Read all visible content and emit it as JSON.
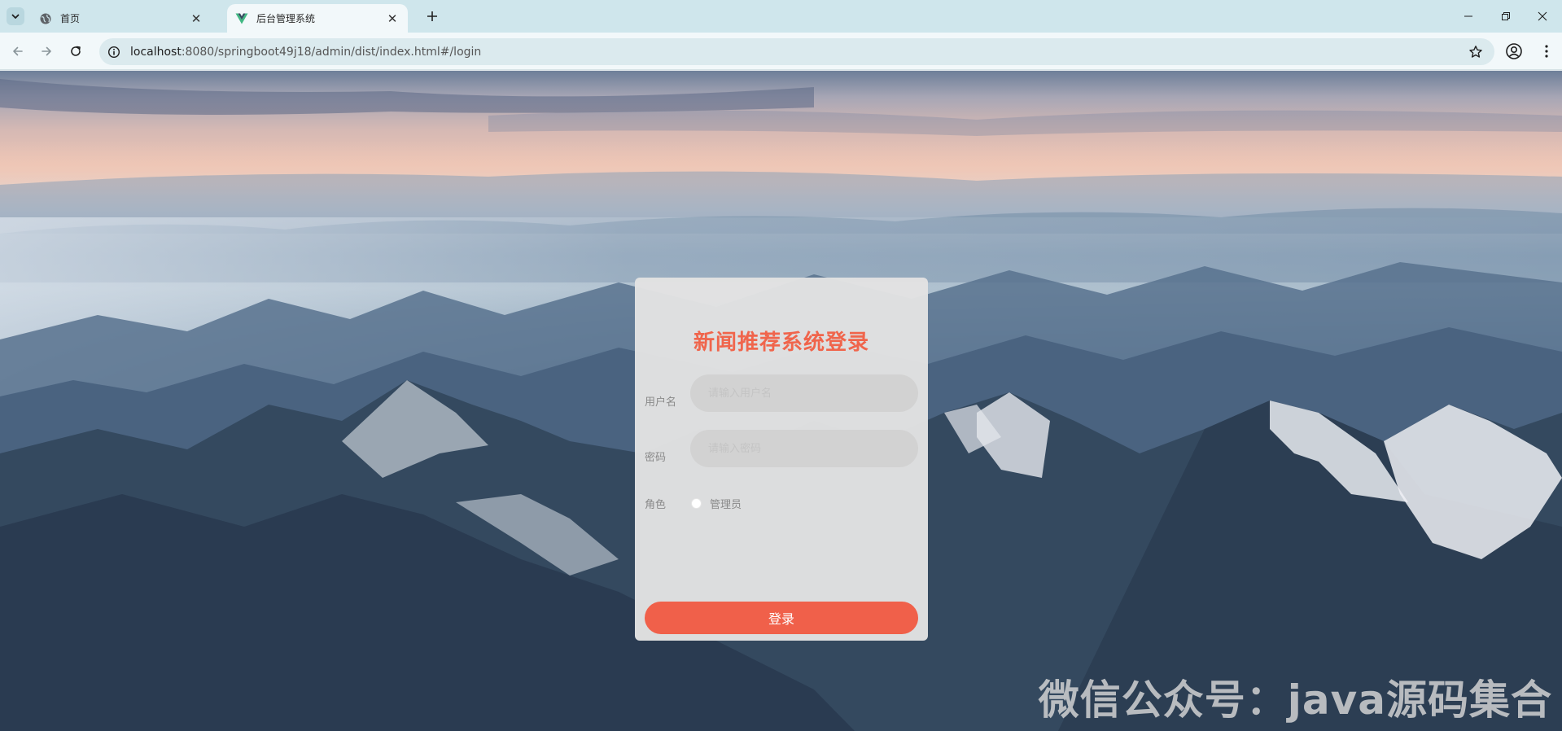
{
  "browser": {
    "tabs": [
      {
        "title": "首页",
        "favicon": "globe-icon",
        "active": false
      },
      {
        "title": "后台管理系统",
        "favicon": "vue-logo-icon",
        "active": true
      }
    ],
    "url": {
      "host": "localhost",
      "path": ":8080/springboot49j18/admin/dist/index.html#/login"
    },
    "icons": {
      "back": "arrow-left-icon",
      "forward": "arrow-right-icon",
      "reload": "reload-icon",
      "site_info": "info-icon",
      "bookmark": "star-icon",
      "profile": "profile-icon",
      "menu": "kebab-menu-icon"
    }
  },
  "login": {
    "title": "新闻推荐系统登录",
    "username_label": "用户名",
    "username_placeholder": "请输入用户名",
    "password_label": "密码",
    "password_placeholder": "请输入密码",
    "role_label": "角色",
    "role_option": "管理员",
    "role_selected": false,
    "submit_label": "登录"
  },
  "watermark": "微信公众号：java源码集合",
  "colors": {
    "title_red": "#f0654c",
    "button_red": "#f0604a",
    "card_bg": "#e2e2e2",
    "input_bg": "#d2d2d2"
  }
}
